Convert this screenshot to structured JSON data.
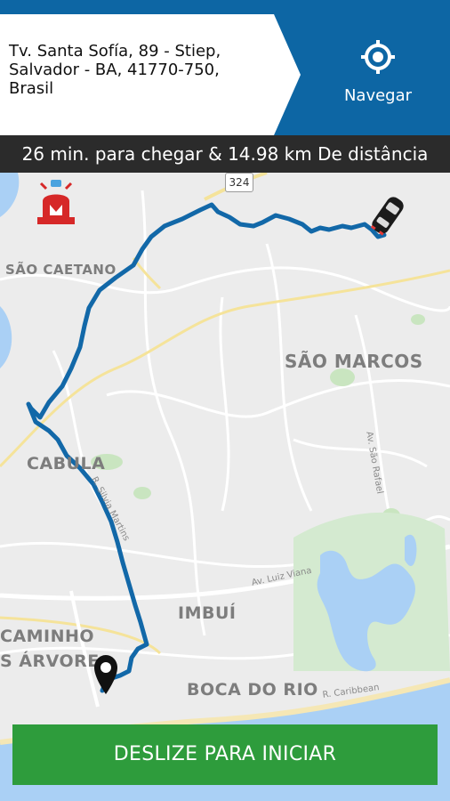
{
  "address": {
    "text": "Tv. Santa Sofía, 89 - Stiep,\nSalvador - BA, 41770-750,\nBrasil"
  },
  "navigate": {
    "label": "Navegar",
    "icon": "crosshair-gps-icon"
  },
  "trip": {
    "eta_text": "26 min. para chegar & 14.98 km De distância"
  },
  "map": {
    "route_shield": "324",
    "neighborhoods": {
      "sao_caetano": "SÃO CAETANO",
      "sao_marcos": "SÃO MARCOS",
      "cabula": "CABULA",
      "imbui": "IMBUÍ",
      "caminho": "CAMINHO",
      "arvores": "S ÁRVORE",
      "boca_do_rio": "BOCA DO RIO"
    },
    "roads": {
      "silvia": "R. Silvia Martins",
      "sao_rafael": "Av. São Rafael",
      "luiz_viana": "Av. Luiz Viana",
      "caribbean": "R. Caribbean"
    },
    "icons": {
      "alert": "emergency-siren-icon",
      "car": "car-marker-icon",
      "destination": "map-pin-icon"
    },
    "colors": {
      "route": "#1268a8",
      "header_blue": "#0d66a4",
      "start_green": "#2e9c3c",
      "water": "#aad0f5"
    }
  },
  "actions": {
    "start_label": "DESLIZE PARA INICIAR"
  }
}
